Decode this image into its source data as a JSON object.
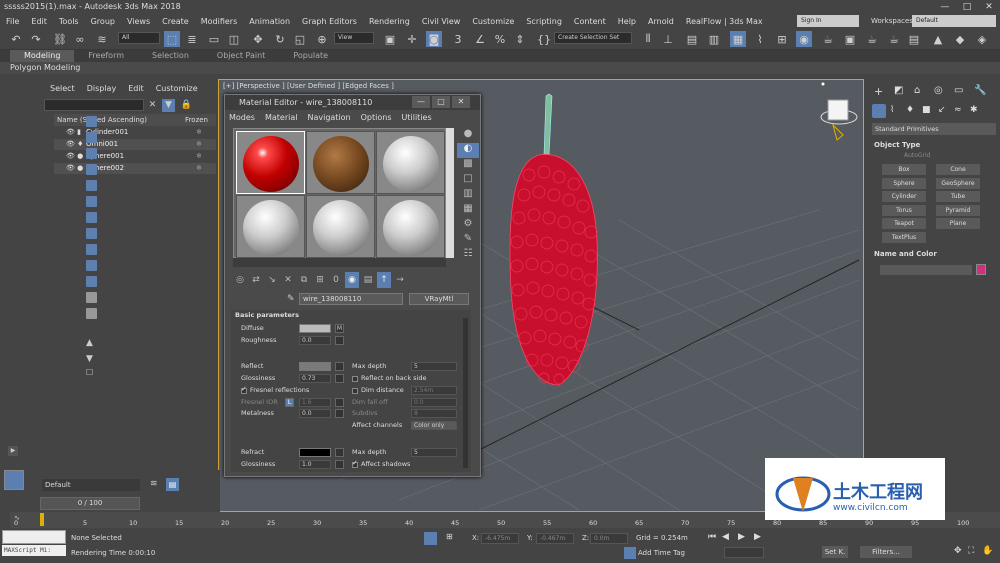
{
  "window": {
    "title": "sssss2015(1).max - Autodesk 3ds Max 2018"
  },
  "menu": [
    "File",
    "Edit",
    "Tools",
    "Group",
    "Views",
    "Create",
    "Modifiers",
    "Animation",
    "Graph Editors",
    "Rendering",
    "Civil View",
    "Customize",
    "Scripting",
    "Content",
    "Help",
    "Arnold",
    "RealFlow | 3ds Max"
  ],
  "account": {
    "signin": "Sign In",
    "workspaces_label": "Workspaces:",
    "workspace": "Default"
  },
  "toolbar": {
    "filter": "All",
    "view": "View",
    "selset": "Create Selection Set"
  },
  "ribbon": {
    "tabs": [
      "Modeling",
      "Freeform",
      "Selection",
      "Object Paint",
      "Populate"
    ],
    "active": "Modeling",
    "sub": "Polygon Modeling"
  },
  "scene": {
    "menu": [
      "Select",
      "Display",
      "Edit",
      "Customize"
    ],
    "header": "Name (Sorted Ascending)",
    "frozen": "Frozen",
    "rows": [
      "Cylinder001",
      "Omni001",
      "Sphere001",
      "Sphere002"
    ]
  },
  "viewport": {
    "label": "[+] [Perspective ] [User Defined ] [Edged Faces ]"
  },
  "matEditor": {
    "title": "Material Editor - wire_138008110",
    "menu": [
      "Modes",
      "Material",
      "Navigation",
      "Options",
      "Utilities"
    ],
    "matName": "wire_138008110",
    "matType": "VRayMtl",
    "rollout": "Basic parameters",
    "p": {
      "diffuse": "Diffuse",
      "m": "M",
      "roughness": "Roughness",
      "roughnessVal": "0.0",
      "reflect": "Reflect",
      "maxDepth": "Max depth",
      "maxDepthVal": "5",
      "gloss": "Glossiness",
      "glossVal": "0.73",
      "reflBack": "Reflect on back side",
      "fresnel": "Fresnel reflections",
      "dimDist": "Dim distance",
      "dimDistVal": "2.54m",
      "fior": "Fresnel IOR",
      "lock": "L",
      "fiorVal": "1.6",
      "dimFall": "Dim fall off",
      "dimFallVal": "0.0",
      "subdivs": "Subdivs",
      "subdivsVal": "8",
      "metal": "Metalness",
      "metalVal": "0.0",
      "affect": "Affect channels",
      "affectVal": "Color only",
      "refract": "Refract",
      "maxDepth2": "Max depth",
      "maxDepth2Val": "5",
      "gloss2": "Glossiness",
      "gloss2Val": "1.0",
      "affectShadows": "Affect shadows"
    }
  },
  "cmd": {
    "category": "Standard Primitives",
    "objType": "Object Type",
    "autogrid": "AutoGrid",
    "buttons": [
      "Box",
      "Cone",
      "Sphere",
      "GeoSphere",
      "Cylinder",
      "Tube",
      "Torus",
      "Pyramid",
      "Teapot",
      "Plane",
      "TextPlus"
    ],
    "nameColor": "Name and Color",
    "swatch": "#d0307a"
  },
  "layer": {
    "name": "Default"
  },
  "time": {
    "frame": "0 / 100",
    "ticks": [
      "0",
      "5",
      "10",
      "15",
      "20",
      "25",
      "30",
      "35",
      "40",
      "45",
      "50",
      "55",
      "60",
      "65",
      "70",
      "75",
      "80",
      "85",
      "90",
      "95",
      "100"
    ]
  },
  "status": {
    "maxscript": "MAXScript Mi:",
    "none": "None Selected",
    "render": "Rendering Time  0:00:10",
    "x": "X:",
    "xv": "-6.475m",
    "y": "Y:",
    "yv": "-0.467m",
    "z": "Z:",
    "zv": "0.0m",
    "grid": "Grid = 0.254m",
    "addTime": "Add Time Tag",
    "setk": "Set K.",
    "filters": "Filters..."
  },
  "watermark": {
    "title": "土木工程网",
    "url": "www.civilcn.com"
  },
  "colors": {
    "accent": "#5a7fb0",
    "viewportBorder": "#c9a43c",
    "berry": "#c8102e"
  }
}
